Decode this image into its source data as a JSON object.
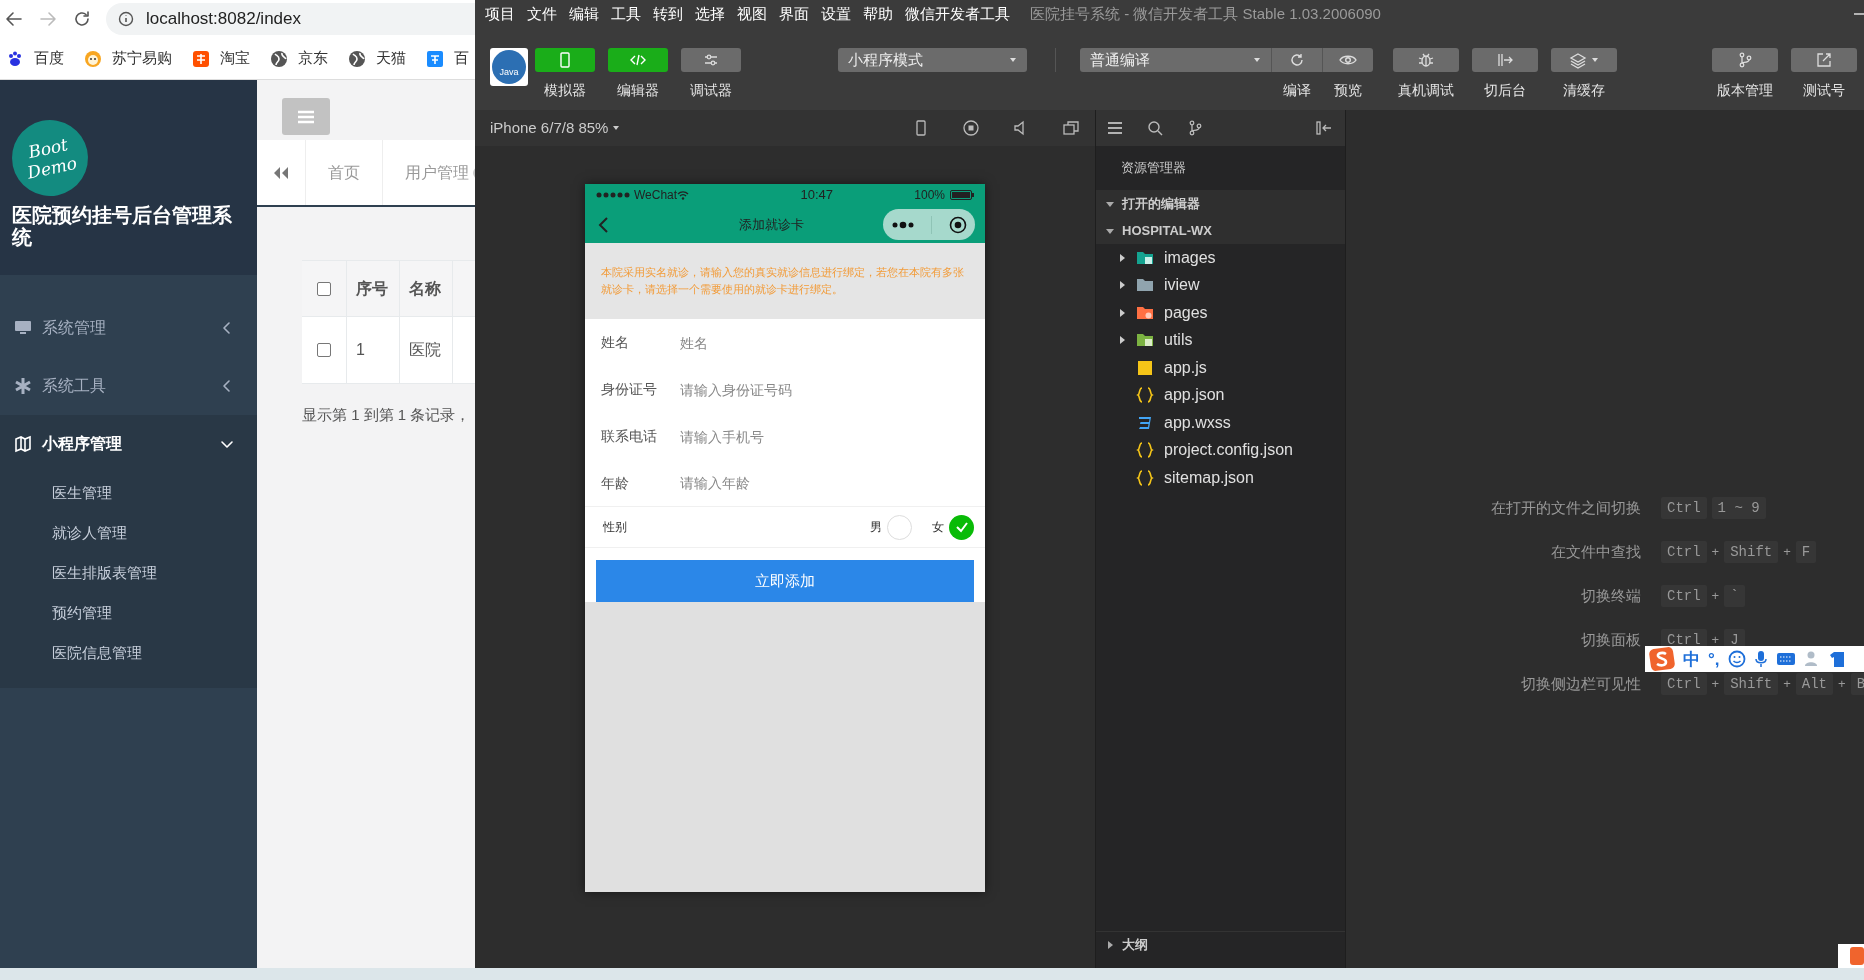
{
  "browser": {
    "url": "localhost:8082/index",
    "bookmarks": [
      {
        "label": "百度",
        "kind": "paw"
      },
      {
        "label": "苏宁易购",
        "kind": "face"
      },
      {
        "label": "淘宝",
        "kind": "tao"
      },
      {
        "label": "京东",
        "kind": "globe"
      },
      {
        "label": "天猫",
        "kind": "globe"
      },
      {
        "label": "百",
        "kind": "translate"
      }
    ]
  },
  "admin": {
    "logo": "Boot Demo",
    "title": "医院预约挂号后台管理系统",
    "menu": [
      {
        "label": "系统管理",
        "kind": "monitor",
        "expanded": false
      },
      {
        "label": "系统工具",
        "kind": "gear",
        "expanded": false
      },
      {
        "label": "小程序管理",
        "kind": "map",
        "expanded": true,
        "children": [
          {
            "label": "医生管理"
          },
          {
            "label": "就诊人管理"
          },
          {
            "label": "医生排版表管理"
          },
          {
            "label": "预约管理"
          },
          {
            "label": "医院信息管理"
          }
        ]
      }
    ],
    "tabs": [
      {
        "label": "首页",
        "selected": false
      },
      {
        "label": "用户管理",
        "selected": false
      }
    ],
    "table": {
      "header_checked": false,
      "columns": [
        "序号",
        "名称"
      ],
      "rows": [
        {
          "checked": false,
          "cells": [
            "1",
            "医院"
          ]
        }
      ]
    },
    "footer": "显示第 1 到第 1 条记录，"
  },
  "devtools": {
    "menu": [
      "项目",
      "文件",
      "编辑",
      "工具",
      "转到",
      "选择",
      "视图",
      "界面",
      "设置",
      "帮助",
      "微信开发者工具"
    ],
    "title": "医院挂号系统 - 微信开发者工具 Stable 1.03.2006090",
    "logo": "Java",
    "views": [
      {
        "label": "模拟器",
        "kind": "phone",
        "on": true
      },
      {
        "label": "编辑器",
        "kind": "code",
        "on": true
      },
      {
        "label": "调试器",
        "kind": "debug",
        "on": false
      }
    ],
    "mode": "小程序模式",
    "compile": "普通编译",
    "compile_actions": [
      {
        "label": "编译",
        "kind": "refresh"
      },
      {
        "label": "预览",
        "kind": "eye"
      }
    ],
    "actions": [
      {
        "label": "真机调试",
        "kind": "bug"
      },
      {
        "label": "切后台",
        "kind": "switch"
      },
      {
        "label": "清缓存",
        "kind": "layers"
      }
    ],
    "right_actions": [
      {
        "label": "版本管理",
        "kind": "branch"
      },
      {
        "label": "测试号",
        "kind": "external"
      }
    ],
    "device": "iPhone 6/7/8 85%",
    "phone": {
      "carrier": "WeChat",
      "time": "10:47",
      "battery": "100%",
      "nav_title": "添加就诊卡",
      "notice": "本院采用实名就诊，请输入您的真实就诊信息进行绑定，若您在本院有多张就诊卡，请选择一个需要使用的就诊卡进行绑定。",
      "fields": [
        {
          "label": "姓名",
          "placeholder": "姓名"
        },
        {
          "label": "身份证号",
          "placeholder": "请输入身份证号码"
        },
        {
          "label": "联系电话",
          "placeholder": "请输入手机号"
        },
        {
          "label": "年龄",
          "placeholder": "请输入年龄"
        }
      ],
      "gender": {
        "label": "性别",
        "options": [
          {
            "label": "男",
            "selected": false
          },
          {
            "label": "女",
            "selected": true
          }
        ]
      },
      "submit": "立即添加"
    },
    "explorer": {
      "title": "资源管理器",
      "sections": [
        {
          "label": "打开的编辑器",
          "expanded": true
        },
        {
          "label": "HOSPITAL-WX",
          "expanded": true
        }
      ],
      "files": [
        {
          "label": "images",
          "kind": "imgfolder",
          "expanded": false
        },
        {
          "label": "iview",
          "kind": "folder",
          "expanded": false
        },
        {
          "label": "pages",
          "kind": "pagefolder",
          "expanded": false
        },
        {
          "label": "utils",
          "kind": "utilfolder",
          "expanded": false
        },
        {
          "label": "app.js",
          "kind": "js"
        },
        {
          "label": "app.json",
          "kind": "json"
        },
        {
          "label": "app.wxss",
          "kind": "css"
        },
        {
          "label": "project.config.json",
          "kind": "json"
        },
        {
          "label": "sitemap.json",
          "kind": "json"
        }
      ],
      "outline": {
        "label": "大纲",
        "expanded": false
      }
    },
    "shortcuts": [
      {
        "label": "在打开的文件之间切换",
        "keys": [
          {
            "kind": "key",
            "text": "Ctrl"
          },
          {
            "kind": "key",
            "text": "1 ~ 9"
          }
        ]
      },
      {
        "label": "在文件中查找",
        "keys": [
          {
            "kind": "key",
            "text": "Ctrl"
          },
          {
            "kind": "sep",
            "text": "+"
          },
          {
            "kind": "key",
            "text": "Shift"
          },
          {
            "kind": "sep",
            "text": "+"
          },
          {
            "kind": "key",
            "text": "F"
          }
        ]
      },
      {
        "label": "切换终端",
        "keys": [
          {
            "kind": "key",
            "text": "Ctrl"
          },
          {
            "kind": "sep",
            "text": "+"
          },
          {
            "kind": "key",
            "text": "`"
          }
        ]
      },
      {
        "label": "切换面板",
        "keys": [
          {
            "kind": "key",
            "text": "Ctrl"
          },
          {
            "kind": "sep",
            "text": "+"
          },
          {
            "kind": "key",
            "text": "J"
          }
        ]
      },
      {
        "label": "切换侧边栏可见性",
        "keys": [
          {
            "kind": "key",
            "text": "Ctrl"
          },
          {
            "kind": "sep",
            "text": "+"
          },
          {
            "kind": "key",
            "text": "Shift"
          },
          {
            "kind": "sep",
            "text": "+"
          },
          {
            "kind": "key",
            "text": "Alt"
          },
          {
            "kind": "sep",
            "text": "+"
          },
          {
            "kind": "key",
            "text": "B"
          }
        ]
      }
    ]
  },
  "ime": {
    "labels": [
      "中",
      "°,"
    ]
  }
}
